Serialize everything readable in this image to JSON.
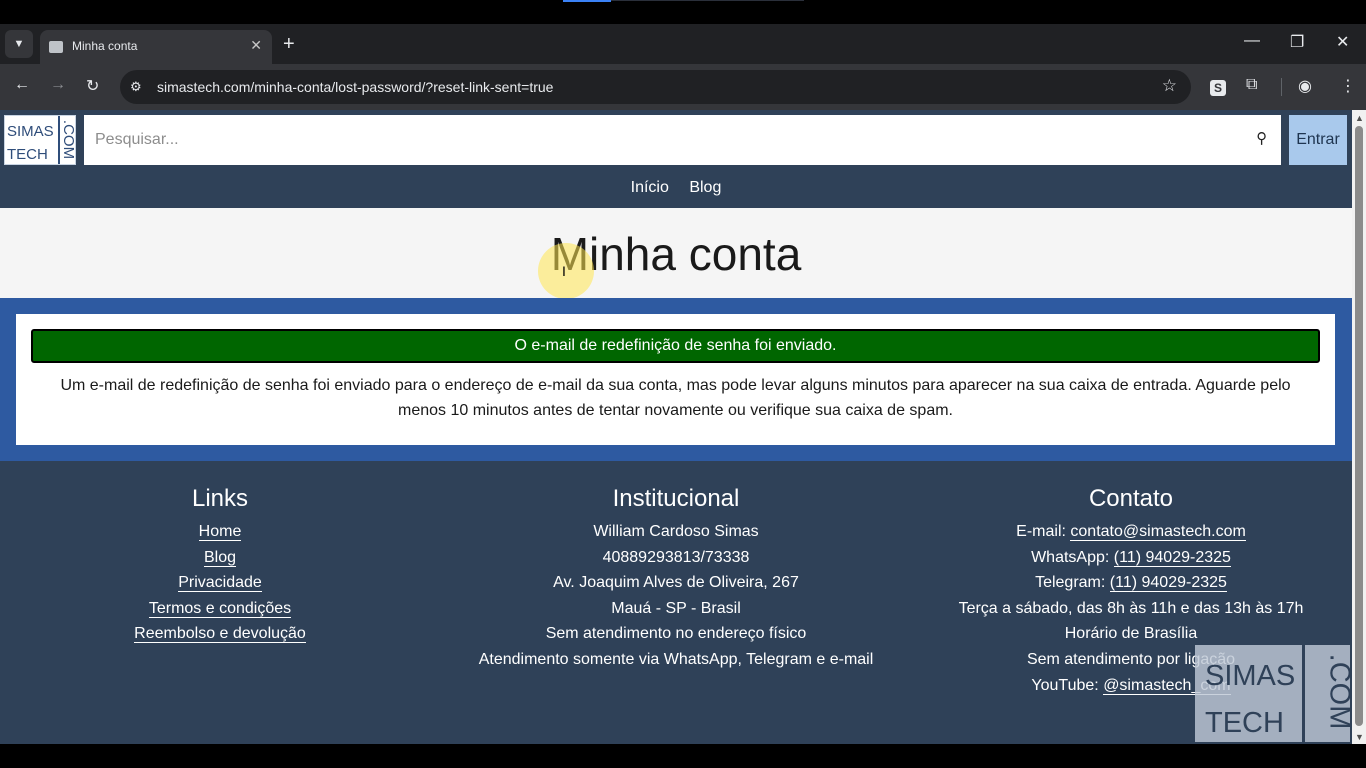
{
  "browser": {
    "tab_title": "Minha conta",
    "url": "simastech.com/minha-conta/lost-password/?reset-link-sent=true"
  },
  "site": {
    "logo": {
      "line1": "SIMAS",
      "line2": "TECH",
      "side": ".COM"
    },
    "search_placeholder": "Pesquisar...",
    "login_label": "Entrar",
    "nav": [
      "Início",
      "Blog"
    ]
  },
  "page": {
    "title": "Minha conta",
    "notice": "O e-mail de redefinição de senha foi enviado.",
    "message": "Um e-mail de redefinição de senha foi enviado para o endereço de e-mail da sua conta, mas pode levar alguns minutos para aparecer na sua caixa de entrada. Aguarde pelo menos 10 minutos antes de tentar novamente ou verifique sua caixa de spam."
  },
  "footer": {
    "links": {
      "heading": "Links",
      "items": [
        "Home",
        "Blog",
        "Privacidade",
        "Termos e condições",
        "Reembolso e devolução"
      ]
    },
    "institucional": {
      "heading": "Institucional",
      "lines": [
        "William Cardoso Simas",
        "40889293813/73338",
        "Av. Joaquim Alves de Oliveira, 267",
        "Mauá - SP - Brasil",
        "Sem atendimento no endereço físico",
        "Atendimento somente via WhatsApp, Telegram e e-mail"
      ]
    },
    "contato": {
      "heading": "Contato",
      "email_label": "E-mail: ",
      "email": "contato@simastech.com",
      "whatsapp_label": "WhatsApp: ",
      "whatsapp": "(11) 94029-2325",
      "telegram_label": "Telegram: ",
      "telegram": "(11) 94029-2325",
      "hours": "Terça a sábado, das 8h às 11h e das 13h às 17h",
      "timezone": "Horário de Brasília",
      "no_calls": "Sem atendimento por ligação",
      "youtube_label": "YouTube: ",
      "youtube": "@simastech_com"
    }
  },
  "watermark": {
    "line1": "SIMAS",
    "line2": "TECH",
    "side": ".COM"
  },
  "colors": {
    "header_bg": "#2f4158",
    "content_bg": "#2e5aa1",
    "notice_bg": "#006600",
    "login_bg": "#a9c9ec"
  }
}
